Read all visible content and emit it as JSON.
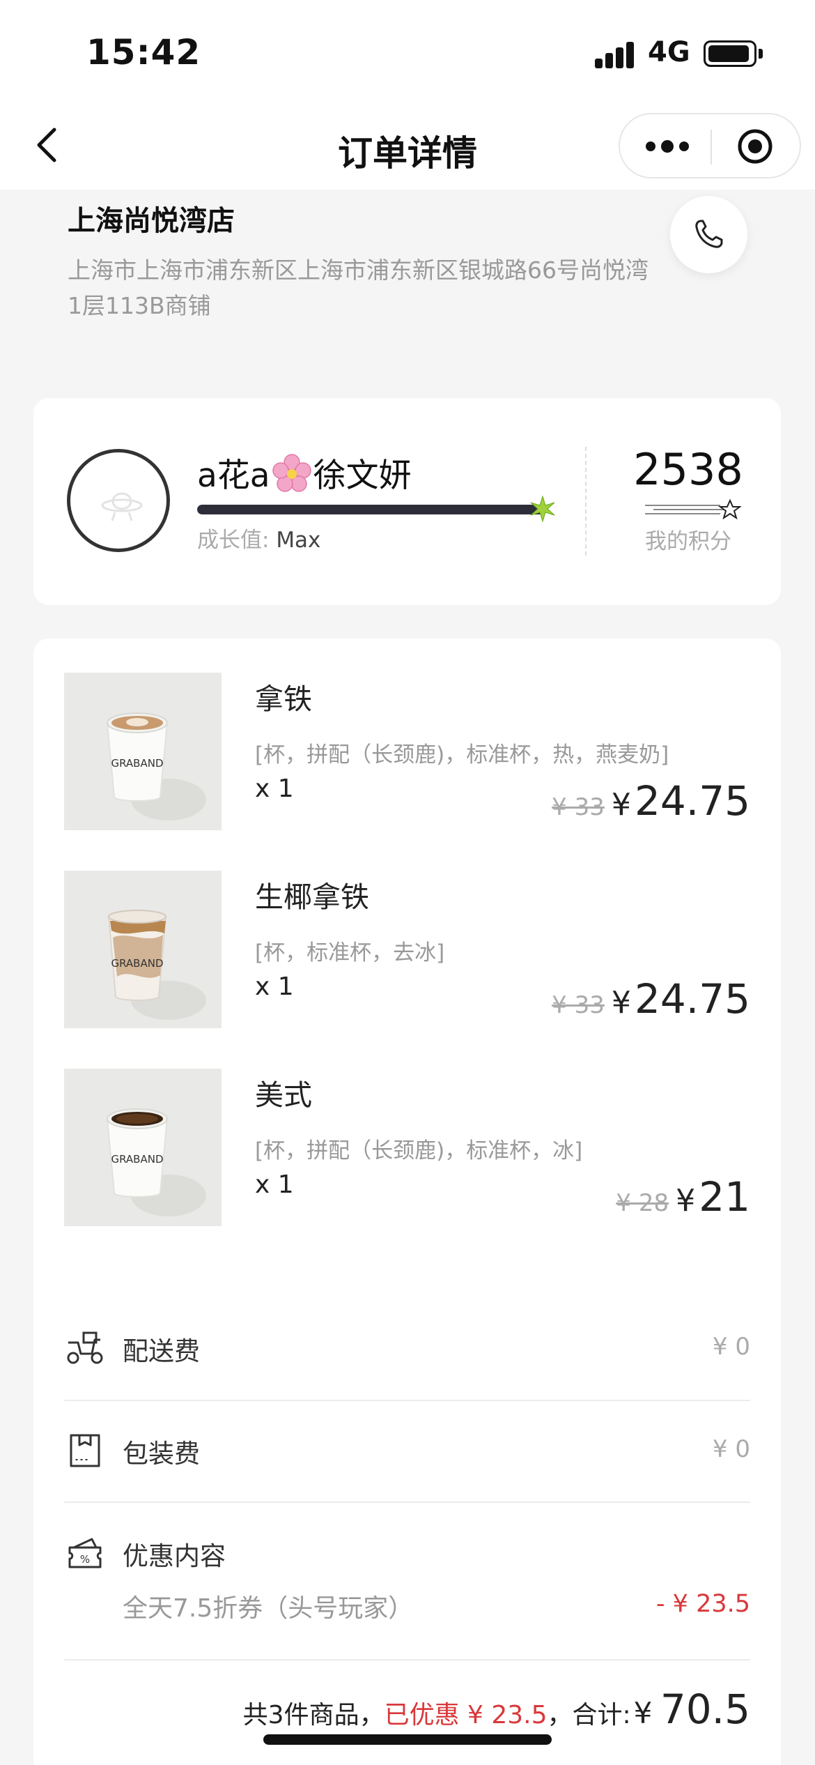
{
  "status_bar": {
    "time": "15:42",
    "network": "4G"
  },
  "nav": {
    "title": "订单详情"
  },
  "store": {
    "name": "上海尚悦湾店",
    "address": "上海市上海市浦东新区上海市浦东新区银城路66号尚悦湾1层113B商铺"
  },
  "member": {
    "name_prefix": "a花a",
    "name_suffix": "徐文妍",
    "growth_label": "成长值:",
    "growth_value": "Max",
    "progress": 1.0,
    "points": "2538",
    "points_label": "我的积分"
  },
  "items": [
    {
      "name": "拿铁",
      "spec": "[杯，拼配（长颈鹿)，标准杯，热，燕麦奶]",
      "qty": "x 1",
      "original_price": "¥ 33",
      "currency": "¥",
      "price": "24.75",
      "image": "hot-latte-cup"
    },
    {
      "name": "生椰拿铁",
      "spec": "[杯，标准杯，去冰]",
      "qty": "x 1",
      "original_price": "¥ 33",
      "currency": "¥",
      "price": "24.75",
      "image": "iced-coconut-latte-cup"
    },
    {
      "name": "美式",
      "spec": "[杯，拼配（长颈鹿)，标准杯，冰]",
      "qty": "x 1",
      "original_price": "¥ 28",
      "currency": "¥",
      "price": "21",
      "image": "americano-cup"
    }
  ],
  "fees": {
    "delivery": {
      "label": "配送费",
      "value": "¥ 0",
      "icon": "scooter-icon"
    },
    "packaging": {
      "label": "包装费",
      "value": "¥ 0",
      "icon": "package-icon"
    },
    "discount": {
      "label": "优惠内容",
      "icon": "coupon-icon",
      "description": "全天7.5折券（头号玩家）",
      "value": "- ¥ 23.5"
    }
  },
  "summary": {
    "count_text": "共3件商品，",
    "discount_text": "已优惠 ¥ 23.5",
    "total_label": "，合计:",
    "currency": "¥",
    "total": "70.5"
  },
  "colors": {
    "accent_red": "#d9383a",
    "muted": "#999999",
    "progress": "#2d2d3a",
    "background": "#f5f5f5"
  }
}
